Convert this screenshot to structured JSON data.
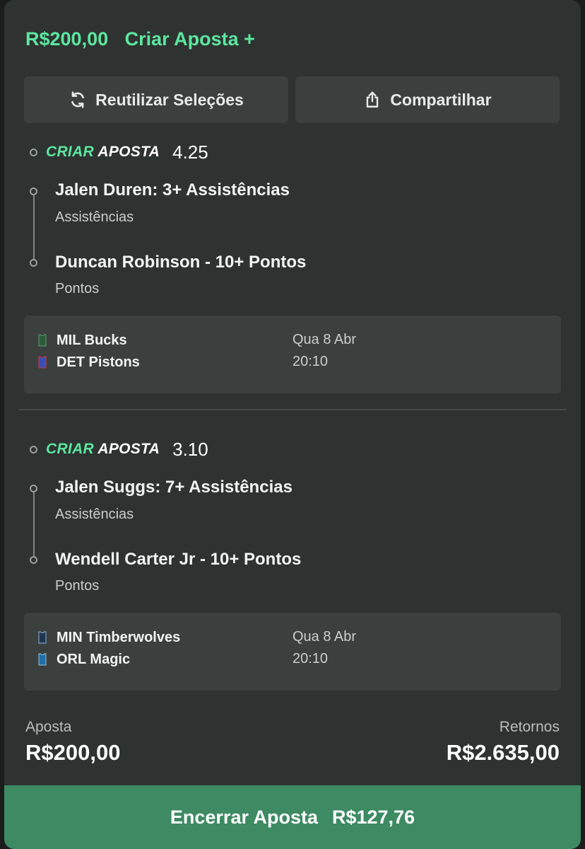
{
  "header": {
    "stake": "R$200,00",
    "create_bet": "Criar Aposta +"
  },
  "actions": {
    "reuse_label": "Reutilizar Seleções",
    "share_label": "Compartilhar"
  },
  "bets": [
    {
      "brand_part1": "CRIAR",
      "brand_part2": "APOSTA",
      "odds": "4.25",
      "selections": [
        {
          "title": "Jalen Duren: 3+ Assistências",
          "market": "Assistências"
        },
        {
          "title": "Duncan Robinson - 10+ Pontos",
          "market": "Pontos"
        }
      ],
      "game": {
        "home": "MIL Bucks",
        "away": "DET Pistons",
        "date": "Qua 8 Abr",
        "time": "20:10",
        "home_color": "#2c5a3a",
        "away_color": "#3a4db0"
      }
    },
    {
      "brand_part1": "CRIAR",
      "brand_part2": "APOSTA",
      "odds": "3.10",
      "selections": [
        {
          "title": "Jalen Suggs: 7+ Assistências",
          "market": "Assistências"
        },
        {
          "title": "Wendell Carter Jr - 10+ Pontos",
          "market": "Pontos"
        }
      ],
      "game": {
        "home": "MIN Timberwolves",
        "away": "ORL Magic",
        "date": "Qua 8 Abr",
        "time": "20:10",
        "home_color": "#1f3550",
        "away_color": "#1e6fa8"
      }
    }
  ],
  "summary": {
    "stake_label": "Aposta",
    "stake_value": "R$200,00",
    "returns_label": "Retornos",
    "returns_value": "R$2.635,00"
  },
  "cashout": {
    "label": "Encerrar Aposta",
    "amount": "R$127,76"
  },
  "colors": {
    "accent": "#5de6a0",
    "card_bg": "#2e3331",
    "panel_bg": "#3b403e",
    "cashout_bg": "#3d8a63"
  }
}
